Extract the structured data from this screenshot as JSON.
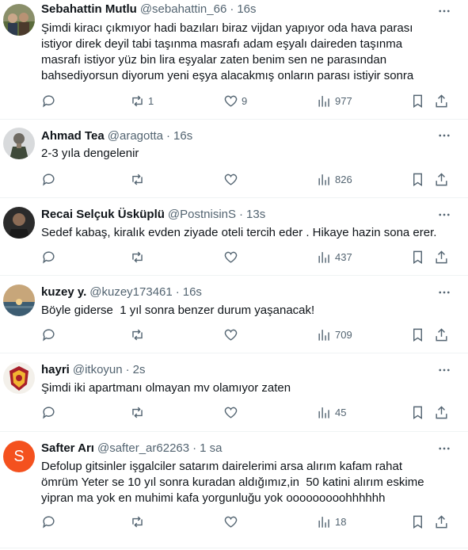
{
  "colors": {
    "text": "#0f1419",
    "muted": "#536471",
    "border": "#eff3f4",
    "avatar_s": "#f4511e"
  },
  "tweets": [
    {
      "name": "Sebahattin Mutlu",
      "handle": "@sebahattin_66",
      "time": "16s",
      "text": "Şimdi kiracı çıkmıyor hadi bazıları biraz vijdan yapıyor oda hava parası\nistiyor direk deyil tabi taşınma masrafı adam eşyalı daireden taşınma\nmasrafı istiyor yüz bin lira eşyalar zaten benim sen ne parasından\nbahsediyorsun diyorum yeni eşya alacakmış onların parası istiyir sonra",
      "reply_count": "",
      "retweet_count": "1",
      "like_count": "9",
      "views": "977",
      "avatar_icon": "photo-group"
    },
    {
      "name": "Ahmad Tea",
      "handle": "@aragotta",
      "time": "16s",
      "text": "2-3 yıla dengelenir",
      "reply_count": "",
      "retweet_count": "",
      "like_count": "",
      "views": "826",
      "avatar_icon": "photo-soldier"
    },
    {
      "name": "Recai Selçuk Üsküplü",
      "handle": "@PostnisinS",
      "time": "13s",
      "text": "Sedef kabaş, kiralık evden ziyade oteli tercih eder . Hikaye hazin sona erer.",
      "reply_count": "",
      "retweet_count": "",
      "like_count": "",
      "views": "437",
      "avatar_icon": "photo-man"
    },
    {
      "name": "kuzey y.",
      "handle": "@kuzey173461",
      "time": "16s",
      "text": "Böyle giderse  1 yıl sonra benzer durum yaşanacak!",
      "reply_count": "",
      "retweet_count": "",
      "like_count": "",
      "views": "709",
      "avatar_icon": "photo-sunset"
    },
    {
      "name": "hayri",
      "handle": "@itkoyun",
      "time": "2s",
      "text": "Şimdi iki apartmanı olmayan mv olamıyor zaten",
      "reply_count": "",
      "retweet_count": "",
      "like_count": "",
      "views": "45",
      "avatar_icon": "photo-emblem"
    },
    {
      "name": "Safter Arı",
      "handle": "@safter_ar62263",
      "time": "1 sa",
      "text": "Defolup gitsinler işgalciler satarım dairelerimi arsa alırım kafam rahat\nömrüm Yeter se 10 yıl sonra kuradan aldığımız,in  50 katini alırım eskime\nyipran ma yok en muhimi kafa yorgunluğu yok ooooooooohhhhhh",
      "reply_count": "",
      "retweet_count": "",
      "like_count": "",
      "views": "18",
      "avatar_letter": "S"
    }
  ]
}
